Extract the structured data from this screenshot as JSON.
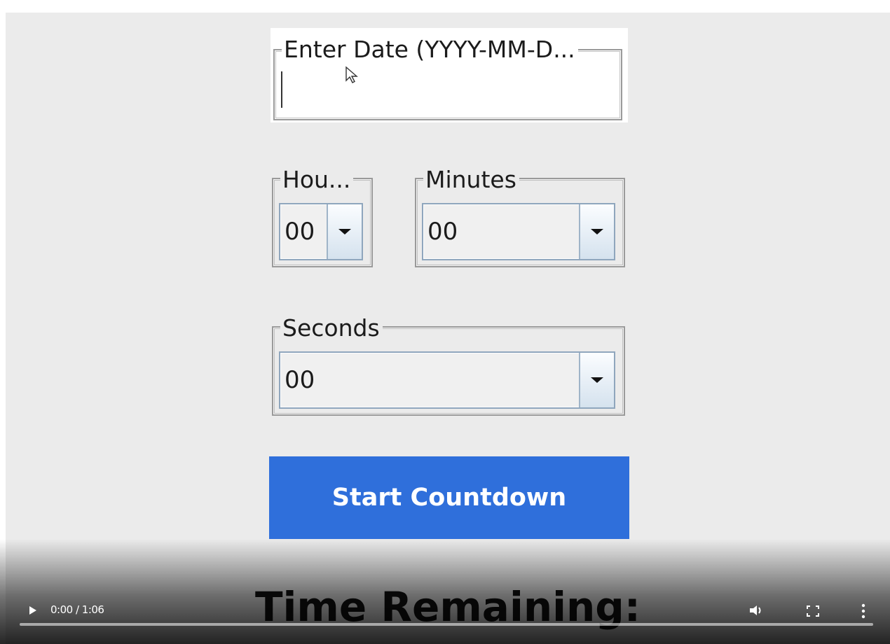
{
  "form": {
    "date": {
      "label": "Enter Date (YYYY-MM-D...",
      "value": ""
    },
    "hours": {
      "label": "Hou...",
      "value": "00"
    },
    "minutes": {
      "label": "Minutes",
      "value": "00"
    },
    "seconds": {
      "label": "Seconds",
      "value": "00"
    },
    "start_label": "Start Countdown",
    "time_remaining_label": "Time Remaining:"
  },
  "player": {
    "time_display": "0:00 / 1:06",
    "progress_fraction": 0.0,
    "icons": [
      "play-icon",
      "volume-icon",
      "fullscreen-icon",
      "more-icon"
    ]
  },
  "colors": {
    "window_bg": "#ebebeb",
    "start_button": "#2f6fdb",
    "start_text": "#ffffff"
  }
}
